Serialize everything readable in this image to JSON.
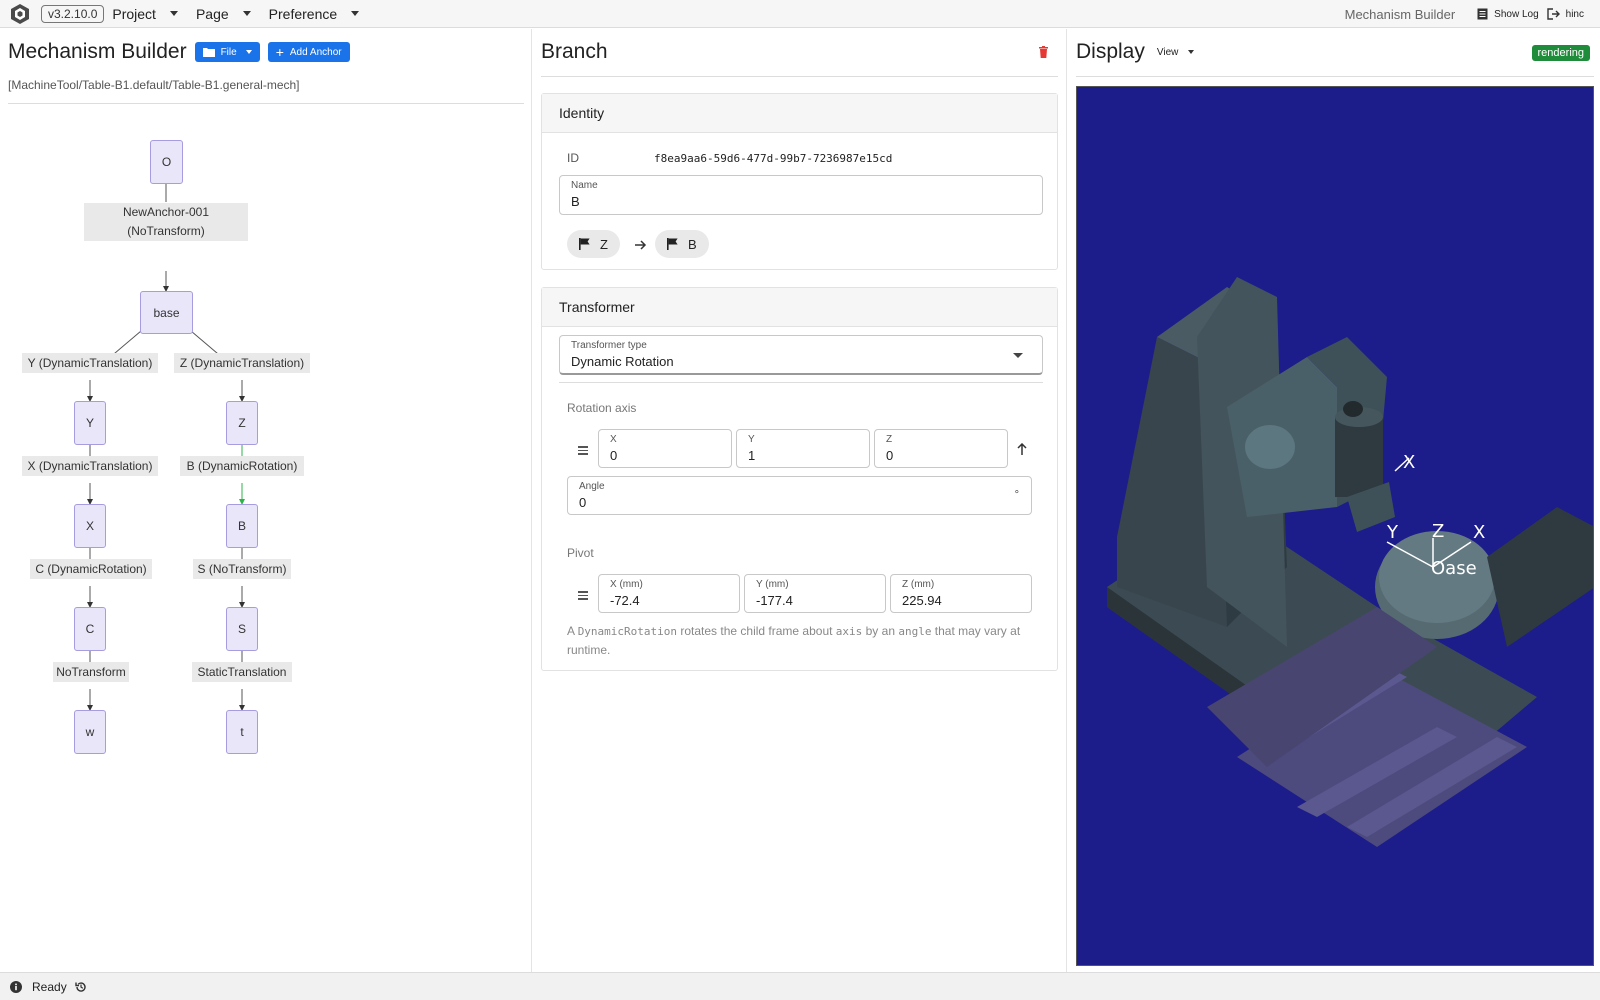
{
  "topbar": {
    "version": "v3.2.10.0",
    "menus": [
      "Project",
      "Page",
      "Preference"
    ],
    "app_name": "Mechanism Builder",
    "show_log": "Show Log",
    "user": "hinc"
  },
  "left": {
    "title": "Mechanism Builder",
    "file_button": "File",
    "add_anchor_button": "Add Anchor",
    "path": "[MachineTool/Table-B1.default/Table-B1.general-mech]",
    "graph": {
      "nodes": [
        "O",
        "base",
        "Y",
        "X",
        "C",
        "w",
        "Z",
        "B",
        "S",
        "t"
      ],
      "edge_labels": {
        "anchor_line1": "NewAnchor-001",
        "anchor_line2": "(NoTransform)",
        "base_y": "Y (DynamicTranslation)",
        "base_z": "Z (DynamicTranslation)",
        "y_x": "X (DynamicTranslation)",
        "x_c": "C (DynamicRotation)",
        "c_w": "NoTransform",
        "z_b": "B (DynamicRotation)",
        "b_s": "S (NoTransform)",
        "s_t": "StaticTranslation"
      }
    }
  },
  "middle": {
    "title": "Branch",
    "identity": {
      "heading": "Identity",
      "id_label": "ID",
      "id_value": "f8ea9aa6-59d6-477d-99b7-7236987e15cd",
      "name_label": "Name",
      "name_value": "B",
      "from_chip": "Z",
      "to_chip": "B"
    },
    "transformer": {
      "heading": "Transformer",
      "type_label": "Transformer type",
      "type_value": "Dynamic Rotation",
      "rotation_axis_label": "Rotation axis",
      "axis": [
        {
          "label": "X",
          "value": "0"
        },
        {
          "label": "Y",
          "value": "1"
        },
        {
          "label": "Z",
          "value": "0"
        }
      ],
      "angle_label": "Angle",
      "angle_value": "0",
      "angle_unit": "°",
      "pivot_label": "Pivot",
      "pivot": [
        {
          "label": "X (mm)",
          "value": "-72.4"
        },
        {
          "label": "Y (mm)",
          "value": "-177.4"
        },
        {
          "label": "Z (mm)",
          "value": "225.94"
        }
      ],
      "help": {
        "p1": "A ",
        "c1": "DynamicRotation",
        "p2": " rotates the child frame about ",
        "c2": "axis",
        "p3": " by an ",
        "c3": "angle",
        "p4": " that may vary at runtime."
      }
    }
  },
  "right": {
    "title": "Display",
    "view_menu": "View",
    "badge": "rendering",
    "viewport_labels": {
      "spindle_x": "X",
      "table_y": "Y",
      "table_z": "Z",
      "table_x": "X",
      "frame_name": "Oase"
    }
  },
  "status": {
    "text": "Ready"
  },
  "colors": {
    "accent": "#1a73e8",
    "viewport_bg": "#1c1c8a",
    "node_fill": "#e8e6f8",
    "node_border": "#a59ddf",
    "badge_green": "#1e8c3a",
    "delete_red": "#e53935"
  }
}
